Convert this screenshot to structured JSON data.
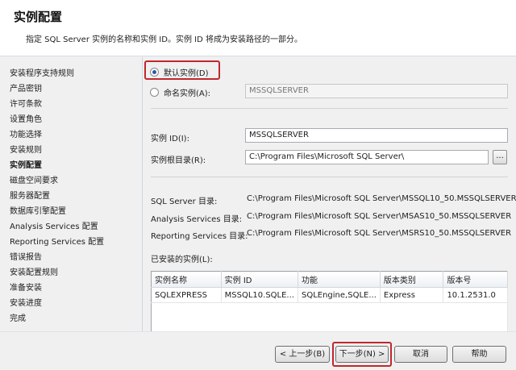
{
  "header": {
    "title": "实例配置",
    "description": "指定 SQL Server 实例的名称和实例 ID。实例 ID 将成为安装路径的一部分。"
  },
  "sidebar": {
    "items": [
      {
        "label": "安装程序支持规则",
        "active": false
      },
      {
        "label": "产品密钥",
        "active": false
      },
      {
        "label": "许可条款",
        "active": false
      },
      {
        "label": "设置角色",
        "active": false
      },
      {
        "label": "功能选择",
        "active": false
      },
      {
        "label": "安装规则",
        "active": false
      },
      {
        "label": "实例配置",
        "active": true
      },
      {
        "label": "磁盘空间要求",
        "active": false
      },
      {
        "label": "服务器配置",
        "active": false
      },
      {
        "label": "数据库引擎配置",
        "active": false
      },
      {
        "label": "Analysis Services 配置",
        "active": false
      },
      {
        "label": "Reporting Services 配置",
        "active": false
      },
      {
        "label": "错误报告",
        "active": false
      },
      {
        "label": "安装配置规则",
        "active": false
      },
      {
        "label": "准备安装",
        "active": false
      },
      {
        "label": "安装进度",
        "active": false
      },
      {
        "label": "完成",
        "active": false
      }
    ]
  },
  "main": {
    "default_instance_label": "默认实例(D)",
    "named_instance_label": "命名实例(A):",
    "named_instance_value": "MSSQLSERVER",
    "instance_id_label": "实例 ID(I):",
    "instance_id_value": "MSSQLSERVER",
    "instance_root_label": "实例根目录(R):",
    "instance_root_value": "C:\\Program Files\\Microsoft SQL Server\\",
    "browse_label": "...",
    "dirs": [
      {
        "label": "SQL Server 目录:",
        "value": "C:\\Program Files\\Microsoft SQL Server\\MSSQL10_50.MSSQLSERVER"
      },
      {
        "label": "Analysis Services 目录:",
        "value": "C:\\Program Files\\Microsoft SQL Server\\MSAS10_50.MSSQLSERVER"
      },
      {
        "label": "Reporting Services 目录:",
        "value": "C:\\Program Files\\Microsoft SQL Server\\MSRS10_50.MSSQLSERVER"
      }
    ],
    "installed_label": "已安装的实例(L):",
    "table": {
      "headers": [
        "实例名称",
        "实例 ID",
        "功能",
        "版本类别",
        "版本号"
      ],
      "rows": [
        [
          "SQLEXPRESS",
          "MSSQL10.SQLE...",
          "SQLEngine,SQLE...",
          "Express",
          "10.1.2531.0"
        ]
      ]
    }
  },
  "footer": {
    "back_label": "< 上一步(B)",
    "next_label": "下一步(N) >",
    "cancel_label": "取消",
    "help_label": "帮助"
  },
  "colors": {
    "highlight": "#c0282e",
    "radio_dot": "#2d5aa8"
  }
}
